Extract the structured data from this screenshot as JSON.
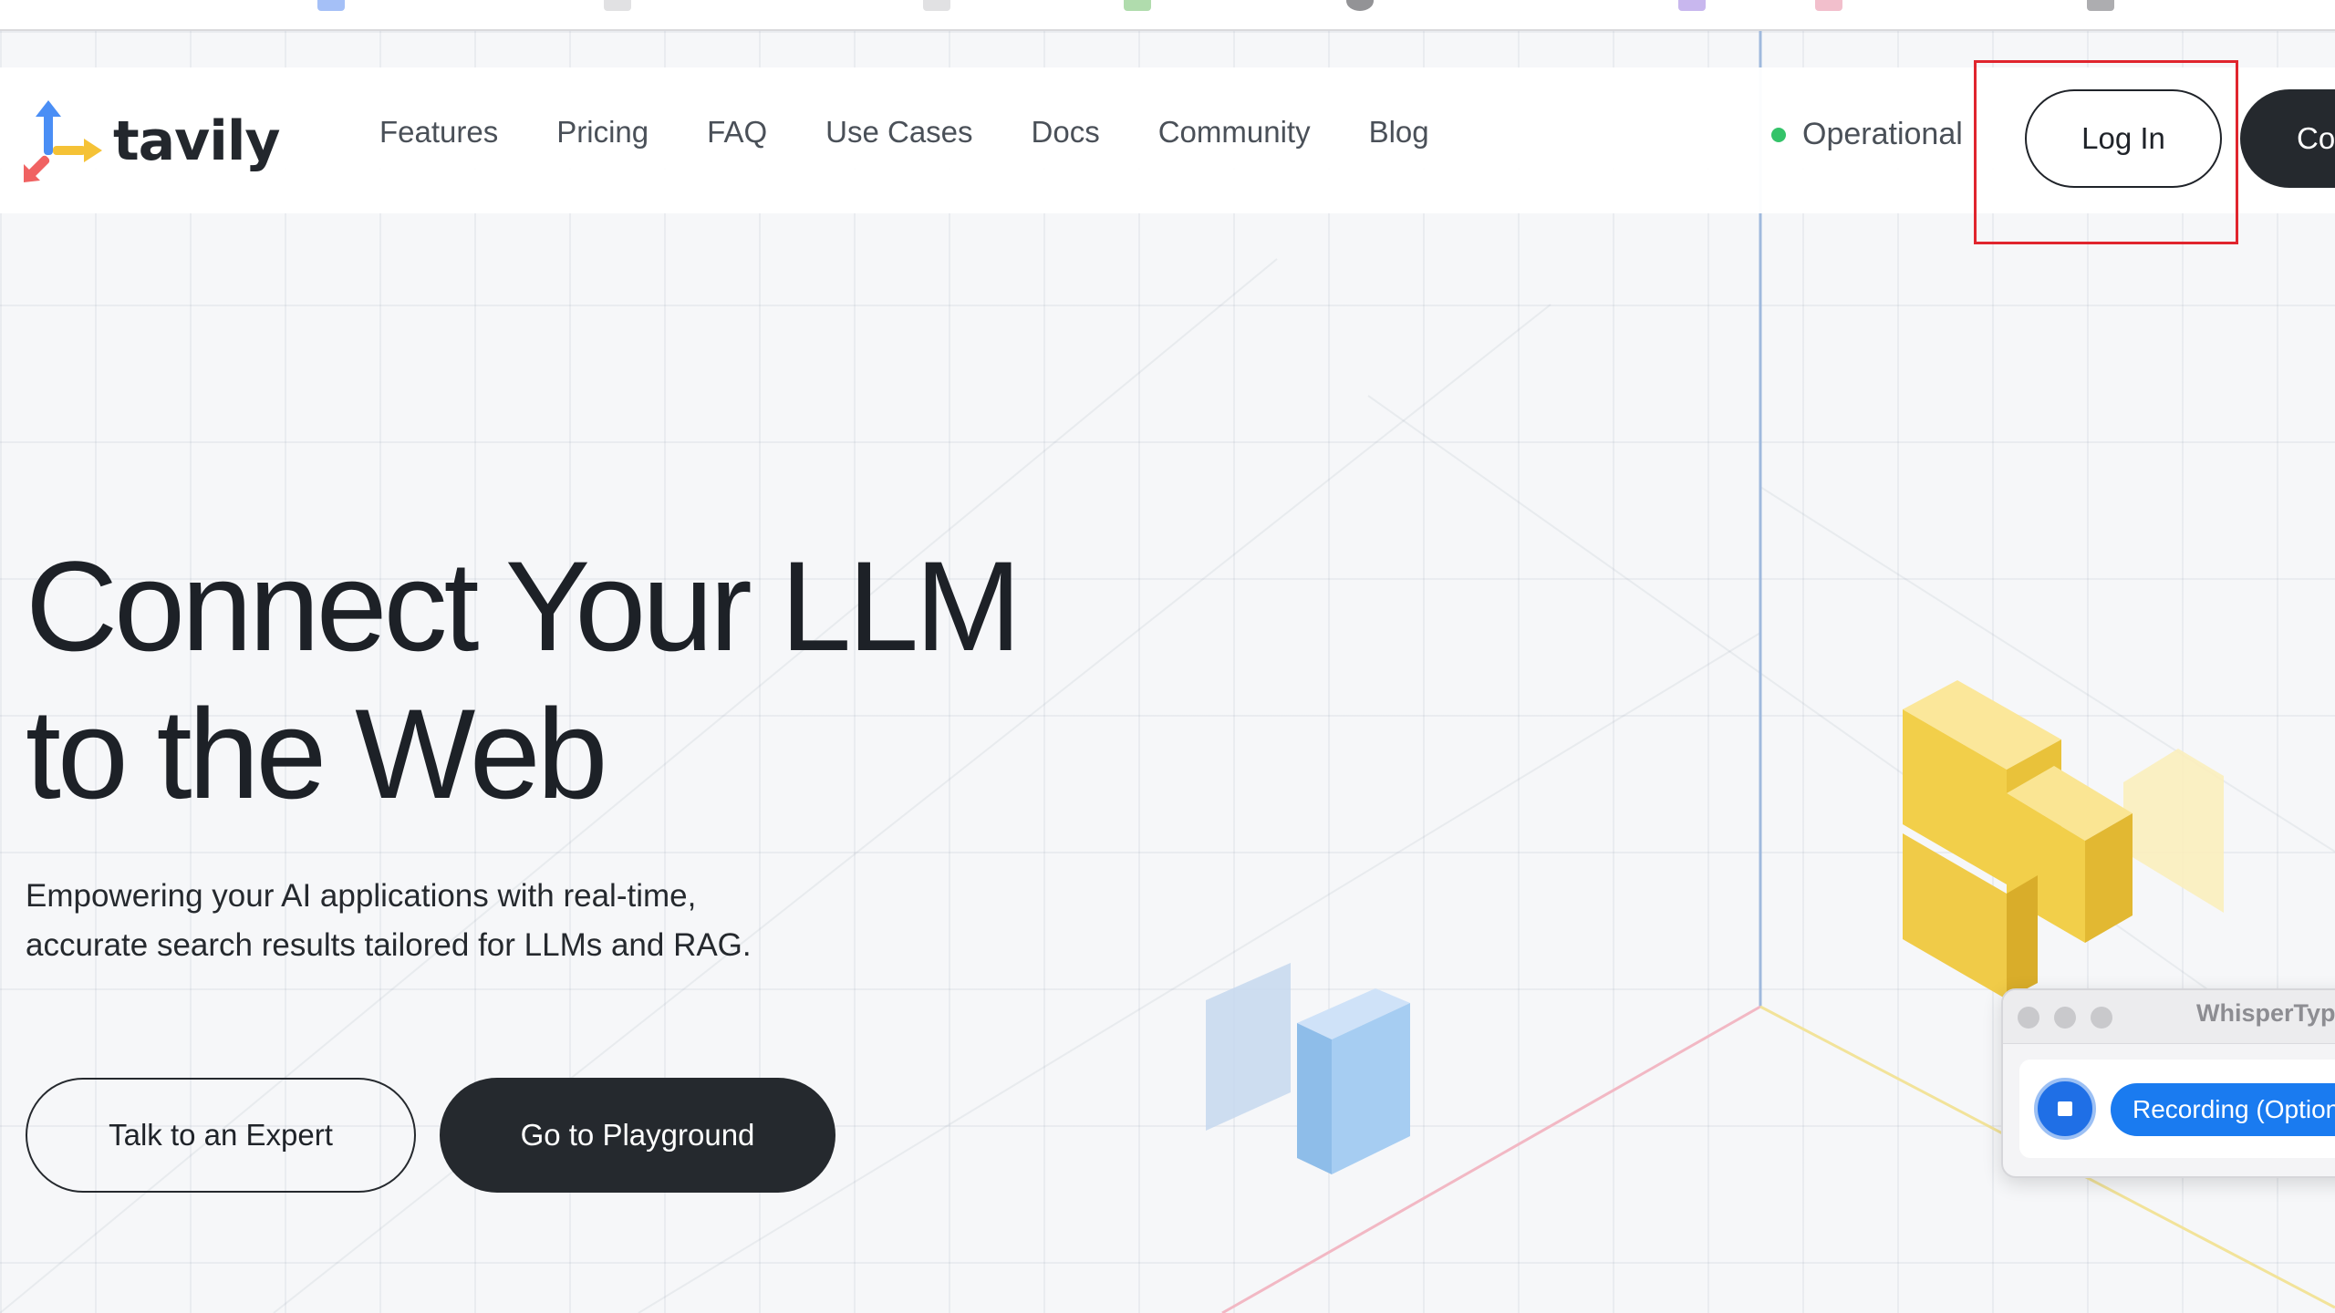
{
  "header": {
    "logo_text": "tavily",
    "nav_items": [
      "Features",
      "Pricing",
      "FAQ",
      "Use Cases",
      "Docs",
      "Community",
      "Blog"
    ],
    "status_label": "Operational",
    "login_label": "Log In",
    "cta_label": "Co"
  },
  "hero": {
    "title_line1": "Connect Your LLM",
    "title_line2": "to the Web",
    "subtitle_line1": "Empowering your AI applications with real-time,",
    "subtitle_line2": "accurate search results tailored for LLMs and RAG.",
    "talk_label": "Talk to an Expert",
    "playground_label": "Go to Playground"
  },
  "whisper_window": {
    "title": "WhisperTyp",
    "recording_label": "Recording (Option-"
  },
  "colors": {
    "status": "#34c369",
    "dark_button": "#25292e",
    "highlight": "#e0252e",
    "recording_blue": "#1a7bf0"
  },
  "icons": [
    "tavily-logo-icon",
    "status-dot-icon",
    "stop-recording-icon"
  ]
}
